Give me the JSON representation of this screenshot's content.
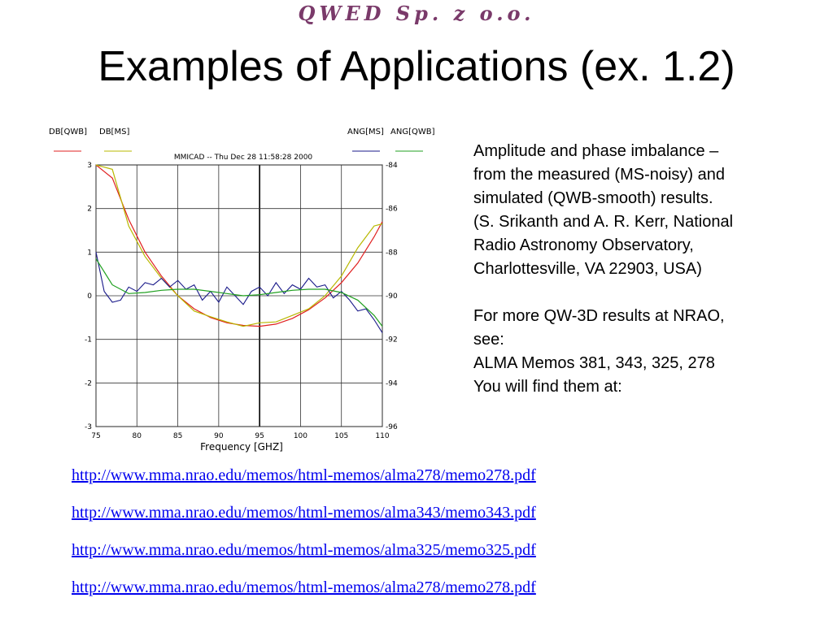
{
  "header": {
    "brand": "QWED Sp. z o.o.",
    "title": "Examples of Applications (ex. 1.2)"
  },
  "chart_data": {
    "type": "line",
    "title": "MMICAD -- Thu Dec 28 11:58:28 2000",
    "xlabel": "Frequency [GHZ]",
    "xlim": [
      75,
      110
    ],
    "x_ticks": [
      "75",
      "80",
      "85",
      "90",
      "95",
      "100",
      "105",
      "110"
    ],
    "ylim_left": [
      -3,
      3
    ],
    "y_ticks_left": [
      "3",
      "2",
      "1",
      "0",
      "-1",
      "-2",
      "-3"
    ],
    "ylim_right": [
      -96,
      -84
    ],
    "y_ticks_right": [
      "-84",
      "-86",
      "-88",
      "-90",
      "-92",
      "-94",
      "-96"
    ],
    "grid": true,
    "legend": [
      "DB[QWB]",
      "DB[MS]",
      "ANG[MS]",
      "ANG[QWB]"
    ],
    "series": [
      {
        "name": "DB[QWB]",
        "axis": "left",
        "color": "#e02020",
        "x": [
          75,
          77,
          79,
          81,
          83,
          85,
          87,
          89,
          91,
          93,
          95,
          97,
          99,
          101,
          103,
          105,
          107,
          109,
          110
        ],
        "y": [
          3.8,
          2.7,
          1.75,
          1.0,
          0.45,
          0.0,
          -0.3,
          -0.5,
          -0.62,
          -0.68,
          -0.7,
          -0.65,
          -0.52,
          -0.32,
          -0.05,
          0.3,
          0.75,
          1.35,
          1.7
        ]
      },
      {
        "name": "DB[MS]",
        "axis": "left",
        "color": "#b8b800",
        "x": [
          75,
          77,
          79,
          81,
          83,
          85,
          87,
          89,
          91,
          93,
          95,
          97,
          99,
          101,
          103,
          105,
          107,
          109,
          110
        ],
        "y": [
          3.5,
          2.9,
          1.6,
          0.9,
          0.4,
          0.0,
          -0.35,
          -0.48,
          -0.6,
          -0.7,
          -0.62,
          -0.6,
          -0.45,
          -0.3,
          0.0,
          0.45,
          1.1,
          1.6,
          1.65
        ]
      },
      {
        "name": "ANG[MS]",
        "axis": "right",
        "color": "#1a1a8a",
        "x": [
          75,
          76,
          77,
          78,
          79,
          80,
          81,
          82,
          83,
          84,
          85,
          86,
          87,
          88,
          89,
          90,
          91,
          92,
          93,
          94,
          95,
          96,
          97,
          98,
          99,
          100,
          101,
          102,
          103,
          104,
          105,
          106,
          107,
          108,
          109,
          110
        ],
        "y": [
          -88,
          -89.8,
          -90.3,
          -90.2,
          -89.6,
          -89.8,
          -89.4,
          -89.5,
          -89.2,
          -89.6,
          -89.3,
          -89.7,
          -89.5,
          -90.2,
          -89.8,
          -90.3,
          -89.6,
          -90.0,
          -90.4,
          -89.8,
          -89.6,
          -90.0,
          -89.4,
          -89.9,
          -89.5,
          -89.7,
          -89.2,
          -89.6,
          -89.5,
          -90.1,
          -89.8,
          -90.2,
          -90.7,
          -90.6,
          -91.1,
          -91.7
        ]
      },
      {
        "name": "ANG[QWB]",
        "axis": "right",
        "color": "#20a020",
        "x": [
          75,
          77,
          79,
          81,
          83,
          85,
          87,
          89,
          91,
          93,
          95,
          97,
          99,
          101,
          103,
          105,
          107,
          109,
          110
        ],
        "y": [
          -88.3,
          -89.5,
          -89.9,
          -89.85,
          -89.75,
          -89.7,
          -89.7,
          -89.8,
          -89.9,
          -90.0,
          -89.95,
          -89.85,
          -89.75,
          -89.7,
          -89.7,
          -89.85,
          -90.2,
          -90.9,
          -91.4
        ]
      }
    ]
  },
  "side": {
    "para1_line1": "Amplitude and phase imbalance –",
    "para1_line2": "from the measured (MS-noisy) and",
    "para1_line3": "simulated (QWB-smooth) results.",
    "para1_line4": "(S. Srikanth and A. R. Kerr, National",
    "para1_line5": "Radio Astronomy Observatory,",
    "para1_line6": "Charlottesville, VA 22903, USA)",
    "para2_line1": "For more QW-3D results at NRAO,",
    "para2_line2": "see:",
    "para2_line3": "ALMA Memos 381, 343, 325, 278",
    "para2_line4": "You will find them at:"
  },
  "links": [
    "http://www.mma.nrao.edu/memos/html-memos/alma278/memo278.pdf",
    "http://www.mma.nrao.edu/memos/html-memos/alma343/memo343.pdf",
    "http://www.mma.nrao.edu/memos/html-memos/alma325/memo325.pdf",
    "http://www.mma.nrao.edu/memos/html-memos/alma278/memo278.pdf"
  ]
}
